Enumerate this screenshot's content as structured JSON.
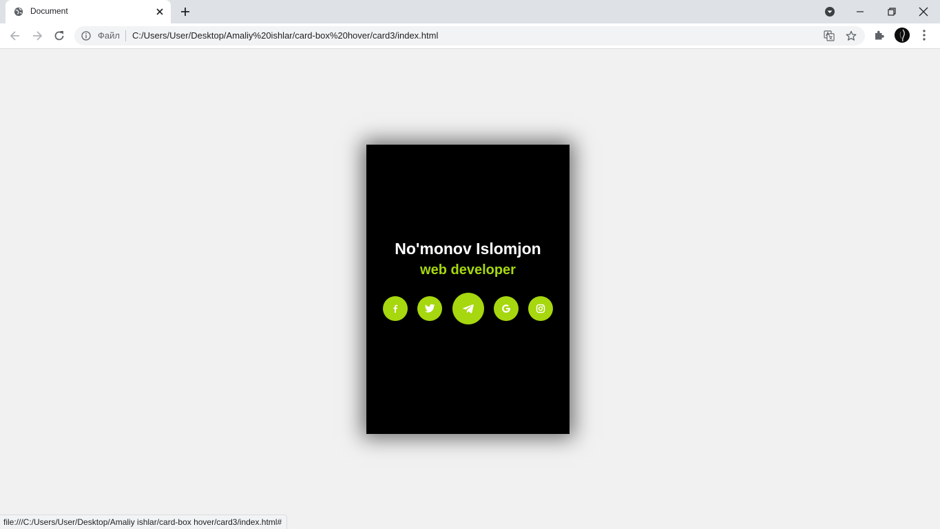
{
  "browser": {
    "tab_title": "Document",
    "omnibox_file_label": "Файл",
    "url": "C:/Users/User/Desktop/Amaliy%20ishlar/card-box%20hover/card3/index.html",
    "status_url": "file:///C:/Users/User/Desktop/Amaliy ishlar/card-box hover/card3/index.html#"
  },
  "card": {
    "name": "No'monov Islomjon",
    "role": "web developer",
    "accent_color": "#a6d70f",
    "socials": [
      {
        "icon": "facebook-icon"
      },
      {
        "icon": "twitter-icon"
      },
      {
        "icon": "telegram-icon",
        "state": "hovered"
      },
      {
        "icon": "google-icon"
      },
      {
        "icon": "instagram-icon"
      }
    ]
  }
}
